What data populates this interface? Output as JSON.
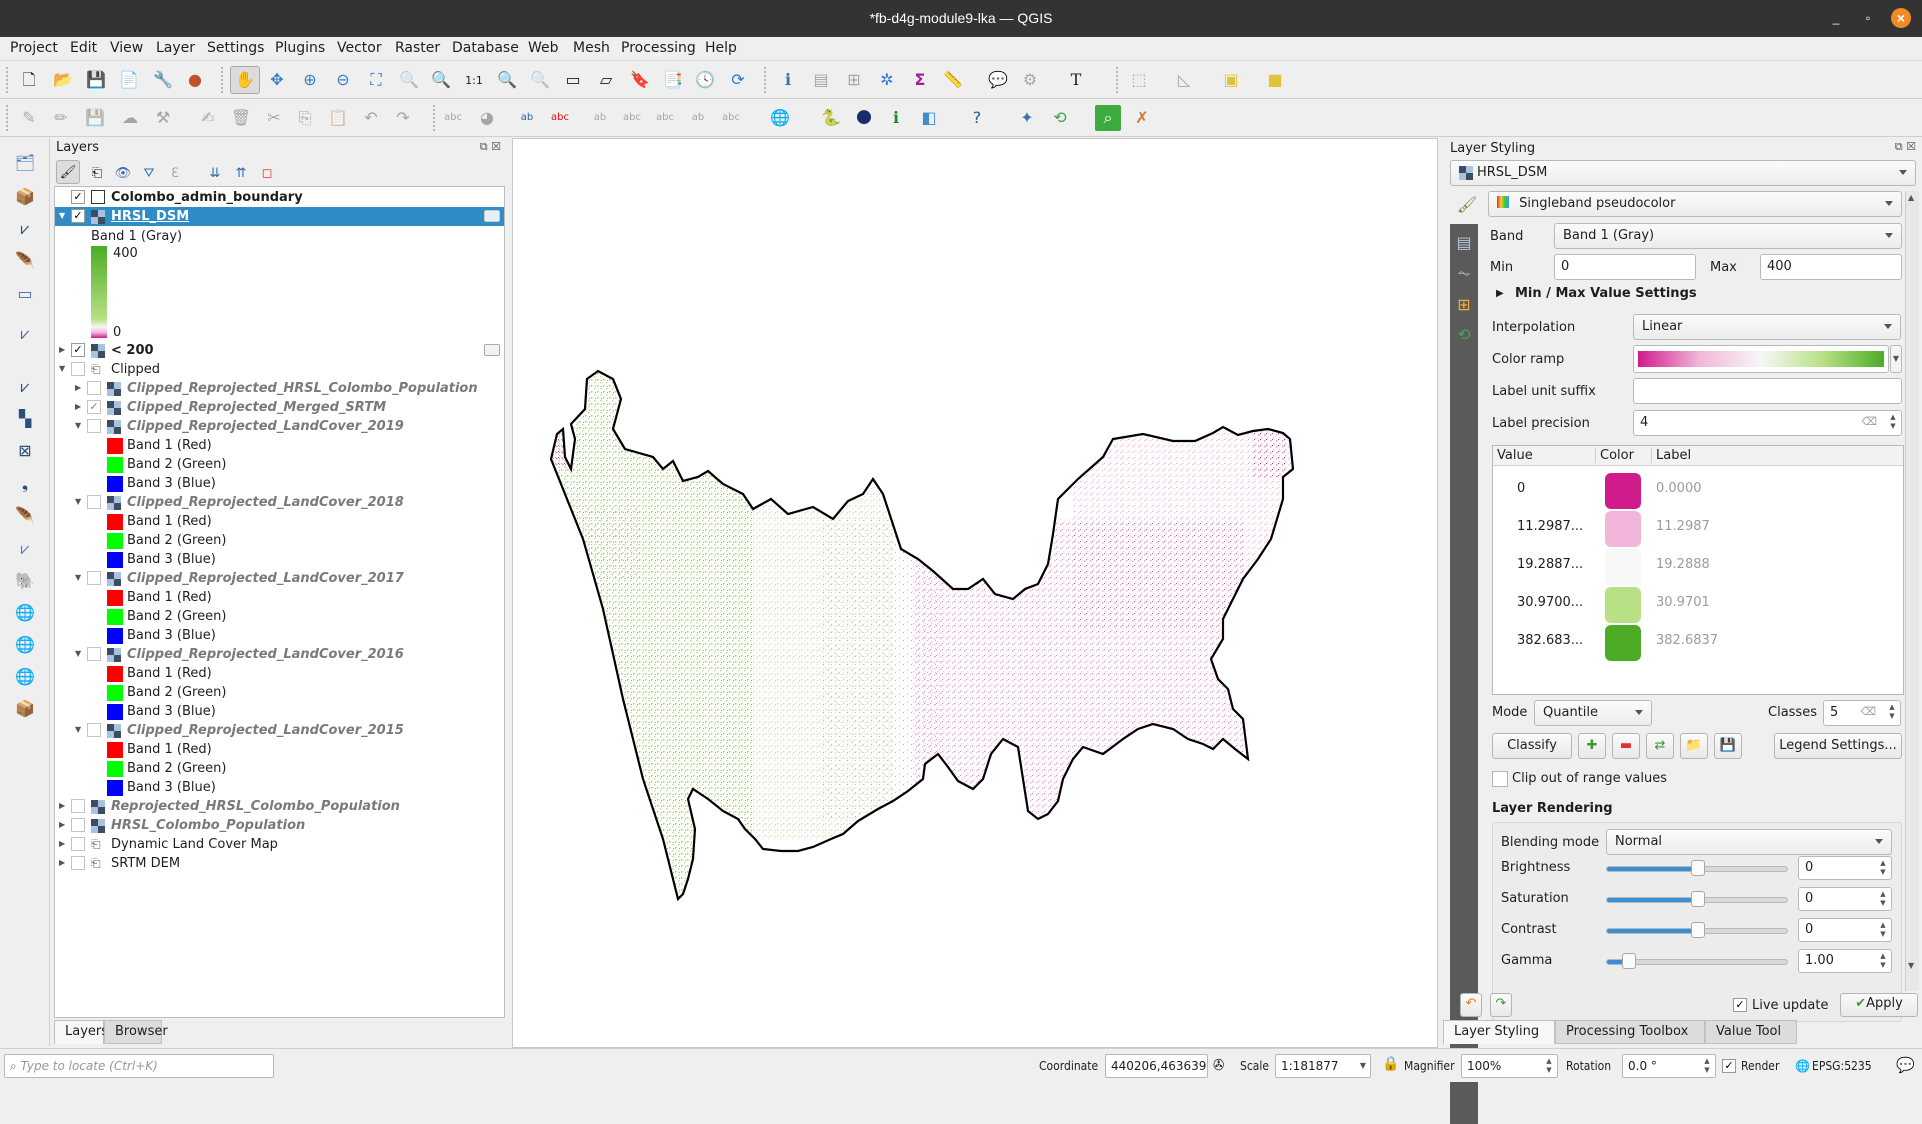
{
  "window": {
    "title": "*fb-d4g-module9-lka — QGIS",
    "min": "_",
    "max": "▫",
    "close": "×"
  },
  "menu": [
    "Project",
    "Edit",
    "View",
    "Layer",
    "Settings",
    "Plugins",
    "Vector",
    "Raster",
    "Database",
    "Web",
    "Mesh",
    "Processing",
    "Help"
  ],
  "layers_panel": {
    "title": "Layers",
    "tree": [
      {
        "name": "Colombo_admin_boundary",
        "checked": true,
        "style": "bold",
        "type": "vector"
      },
      {
        "name": "HRSL_DSM",
        "checked": true,
        "style": "bold-selected",
        "type": "raster",
        "expanded": true
      },
      {
        "name": "Band 1 (Gray)",
        "type": "legend-title"
      },
      {
        "name": "400",
        "type": "legend-max"
      },
      {
        "name": "0",
        "type": "legend-min"
      },
      {
        "name": "< 200",
        "checked": true,
        "style": "bold",
        "type": "raster"
      },
      {
        "name": "Clipped",
        "checked": false,
        "type": "group",
        "expanded": true
      },
      {
        "name": "Clipped_Reprojected_HRSL_Colombo_Population",
        "checked": false,
        "style": "italic",
        "type": "raster"
      },
      {
        "name": "Clipped_Reprojected_Merged_SRTM",
        "checked": true,
        "style": "italic",
        "type": "raster"
      },
      {
        "name": "Clipped_Reprojected_LandCover_2019",
        "checked": false,
        "style": "italic",
        "type": "raster",
        "bands": [
          "Band 1 (Red)",
          "Band 2 (Green)",
          "Band 3 (Blue)"
        ]
      },
      {
        "name": "Clipped_Reprojected_LandCover_2018",
        "checked": false,
        "style": "italic",
        "type": "raster",
        "bands": [
          "Band 1 (Red)",
          "Band 2 (Green)",
          "Band 3 (Blue)"
        ]
      },
      {
        "name": "Clipped_Reprojected_LandCover_2017",
        "checked": false,
        "style": "italic",
        "type": "raster",
        "bands": [
          "Band 1 (Red)",
          "Band 2 (Green)",
          "Band 3 (Blue)"
        ]
      },
      {
        "name": "Clipped_Reprojected_LandCover_2016",
        "checked": false,
        "style": "italic",
        "type": "raster",
        "bands": [
          "Band 1 (Red)",
          "Band 2 (Green)",
          "Band 3 (Blue)"
        ]
      },
      {
        "name": "Clipped_Reprojected_LandCover_2015",
        "checked": false,
        "style": "italic",
        "type": "raster",
        "bands": [
          "Band 1 (Red)",
          "Band 2 (Green)",
          "Band 3 (Blue)"
        ]
      },
      {
        "name": "Reprojected_HRSL_Colombo_Population",
        "checked": false,
        "style": "italic",
        "type": "raster"
      },
      {
        "name": "HRSL_Colombo_Population",
        "checked": false,
        "style": "italic",
        "type": "raster"
      },
      {
        "name": "Dynamic Land Cover Map",
        "checked": false,
        "type": "group"
      },
      {
        "name": "SRTM DEM",
        "checked": false,
        "type": "group"
      }
    ],
    "band_colors": {
      "red": "#ff0000",
      "green": "#00ff00",
      "blue": "#0000ff"
    },
    "tabs": [
      "Layers",
      "Browser"
    ]
  },
  "styling": {
    "title": "Layer Styling",
    "layer": "HRSL_DSM",
    "renderer": "Singleband pseudocolor",
    "band_label": "Band",
    "band": "Band 1 (Gray)",
    "min_label": "Min",
    "min": "0",
    "max_label": "Max",
    "max": "400",
    "minmax_section": "Min / Max Value Settings",
    "interp_label": "Interpolation",
    "interpolation": "Linear",
    "ramp_label": "Color ramp",
    "suffix_label": "Label unit suffix",
    "suffix": "",
    "precision_label": "Label precision",
    "precision": "4",
    "table_headers": [
      "Value",
      "Color",
      "Label"
    ],
    "classes_table": [
      {
        "value": "0",
        "color": "#d01c8b",
        "label": "0.0000"
      },
      {
        "value": "11.2987...",
        "color": "#f1b6da",
        "label": "11.2987"
      },
      {
        "value": "19.2887...",
        "color": "#f7f7f7",
        "label": "19.2888"
      },
      {
        "value": "30.9700...",
        "color": "#b8e186",
        "label": "30.9701"
      },
      {
        "value": "382.683...",
        "color": "#4dac26",
        "label": "382.6837"
      }
    ],
    "mode_label": "Mode",
    "mode": "Quantile",
    "classes_label": "Classes",
    "classes": "5",
    "classify": "Classify",
    "legend_settings": "Legend Settings...",
    "clip_label": "Clip out of range values",
    "rendering_title": "Layer Rendering",
    "blend_label": "Blending mode",
    "blend": "Normal",
    "sliders": [
      {
        "label": "Brightness",
        "value": "0",
        "fraction": 0.5
      },
      {
        "label": "Saturation",
        "value": "0",
        "fraction": 0.5
      },
      {
        "label": "Contrast",
        "value": "0",
        "fraction": 0.5
      },
      {
        "label": "Gamma",
        "value": "1.00",
        "fraction": 0.12
      }
    ],
    "live_update": "Live update",
    "apply": "Apply",
    "tabs": [
      "Layer Styling",
      "Processing Toolbox",
      "Value Tool"
    ]
  },
  "status": {
    "locate_placeholder": "Type to locate (Ctrl+K)",
    "coordinate_label": "Coordinate",
    "coordinate": "440206,463639",
    "scale_label": "Scale",
    "scale": "1:181877",
    "magnifier_label": "Magnifier",
    "magnifier": "100%",
    "rotation_label": "Rotation",
    "rotation": "0.0 °",
    "render_label": "Render",
    "crs": "EPSG:5235"
  },
  "colors": {
    "ramp_start": "#d01c8b",
    "ramp_mid": "#f7f7f7",
    "ramp_end": "#4dac26",
    "selection": "#308cc6"
  }
}
